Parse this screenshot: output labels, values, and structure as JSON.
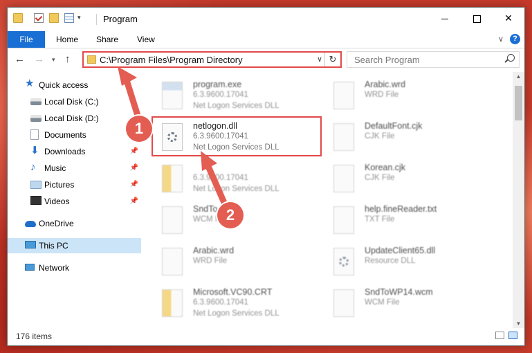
{
  "window": {
    "title": "Program"
  },
  "ribbon": {
    "tabs": [
      "File",
      "Home",
      "Share",
      "View"
    ],
    "help": "?"
  },
  "nav": {
    "address": "C:\\Program Files\\Program Directory",
    "search_placeholder": "Search Program"
  },
  "sidebar": {
    "items": [
      {
        "label": "Quick access",
        "icon": "star-icon"
      },
      {
        "label": "Local Disk (C:)",
        "icon": "disk-icon"
      },
      {
        "label": "Local Disk (D:)",
        "icon": "disk-icon"
      },
      {
        "label": "Documents",
        "icon": "documents-icon"
      },
      {
        "label": "Downloads",
        "icon": "download-icon"
      },
      {
        "label": "Music",
        "icon": "music-icon"
      },
      {
        "label": "Pictures",
        "icon": "pictures-icon"
      },
      {
        "label": "Videos",
        "icon": "videos-icon"
      },
      {
        "label": "OneDrive",
        "icon": "cloud-icon"
      },
      {
        "label": "This PC",
        "icon": "pc-icon"
      },
      {
        "label": "Network",
        "icon": "network-icon"
      }
    ]
  },
  "files": [
    {
      "name": "program.exe",
      "line2": "6.3.9600.17041",
      "line3": "Net Logon Services DLL"
    },
    {
      "name": "Arabic.wrd",
      "line2": "WRD File",
      "line3": ""
    },
    {
      "name": "netlogon.dll",
      "line2": "6.3.9600.17041",
      "line3": "Net Logon Services DLL"
    },
    {
      "name": "DefaultFont.cjk",
      "line2": "CJK File",
      "line3": ""
    },
    {
      "name": "",
      "line2": "6.3.9600.17041",
      "line3": "Net Logon Services DLL"
    },
    {
      "name": "Korean.cjk",
      "line2": "CJK File",
      "line3": ""
    },
    {
      "name": "SndTo...wcm",
      "line2": "WCM File",
      "line3": ""
    },
    {
      "name": "help.fineReader.txt",
      "line2": "TXT File",
      "line3": ""
    },
    {
      "name": "Arabic.wrd",
      "line2": "WRD File",
      "line3": ""
    },
    {
      "name": "UpdateClient65.dll",
      "line2": "Resource DLL",
      "line3": ""
    },
    {
      "name": "Microsoft.VC90.CRT",
      "line2": "6.3.9600.17041",
      "line3": "Net Logon Services DLL"
    },
    {
      "name": "SndToWP14.wcm",
      "line2": "WCM File",
      "line3": ""
    }
  ],
  "status": {
    "count": "176 items"
  },
  "annotations": {
    "step1": "1",
    "step2": "2"
  },
  "colors": {
    "accent": "#1a6fd4",
    "highlight": "#e34949",
    "badge": "#e35d53",
    "selected": "#cce4f7"
  }
}
